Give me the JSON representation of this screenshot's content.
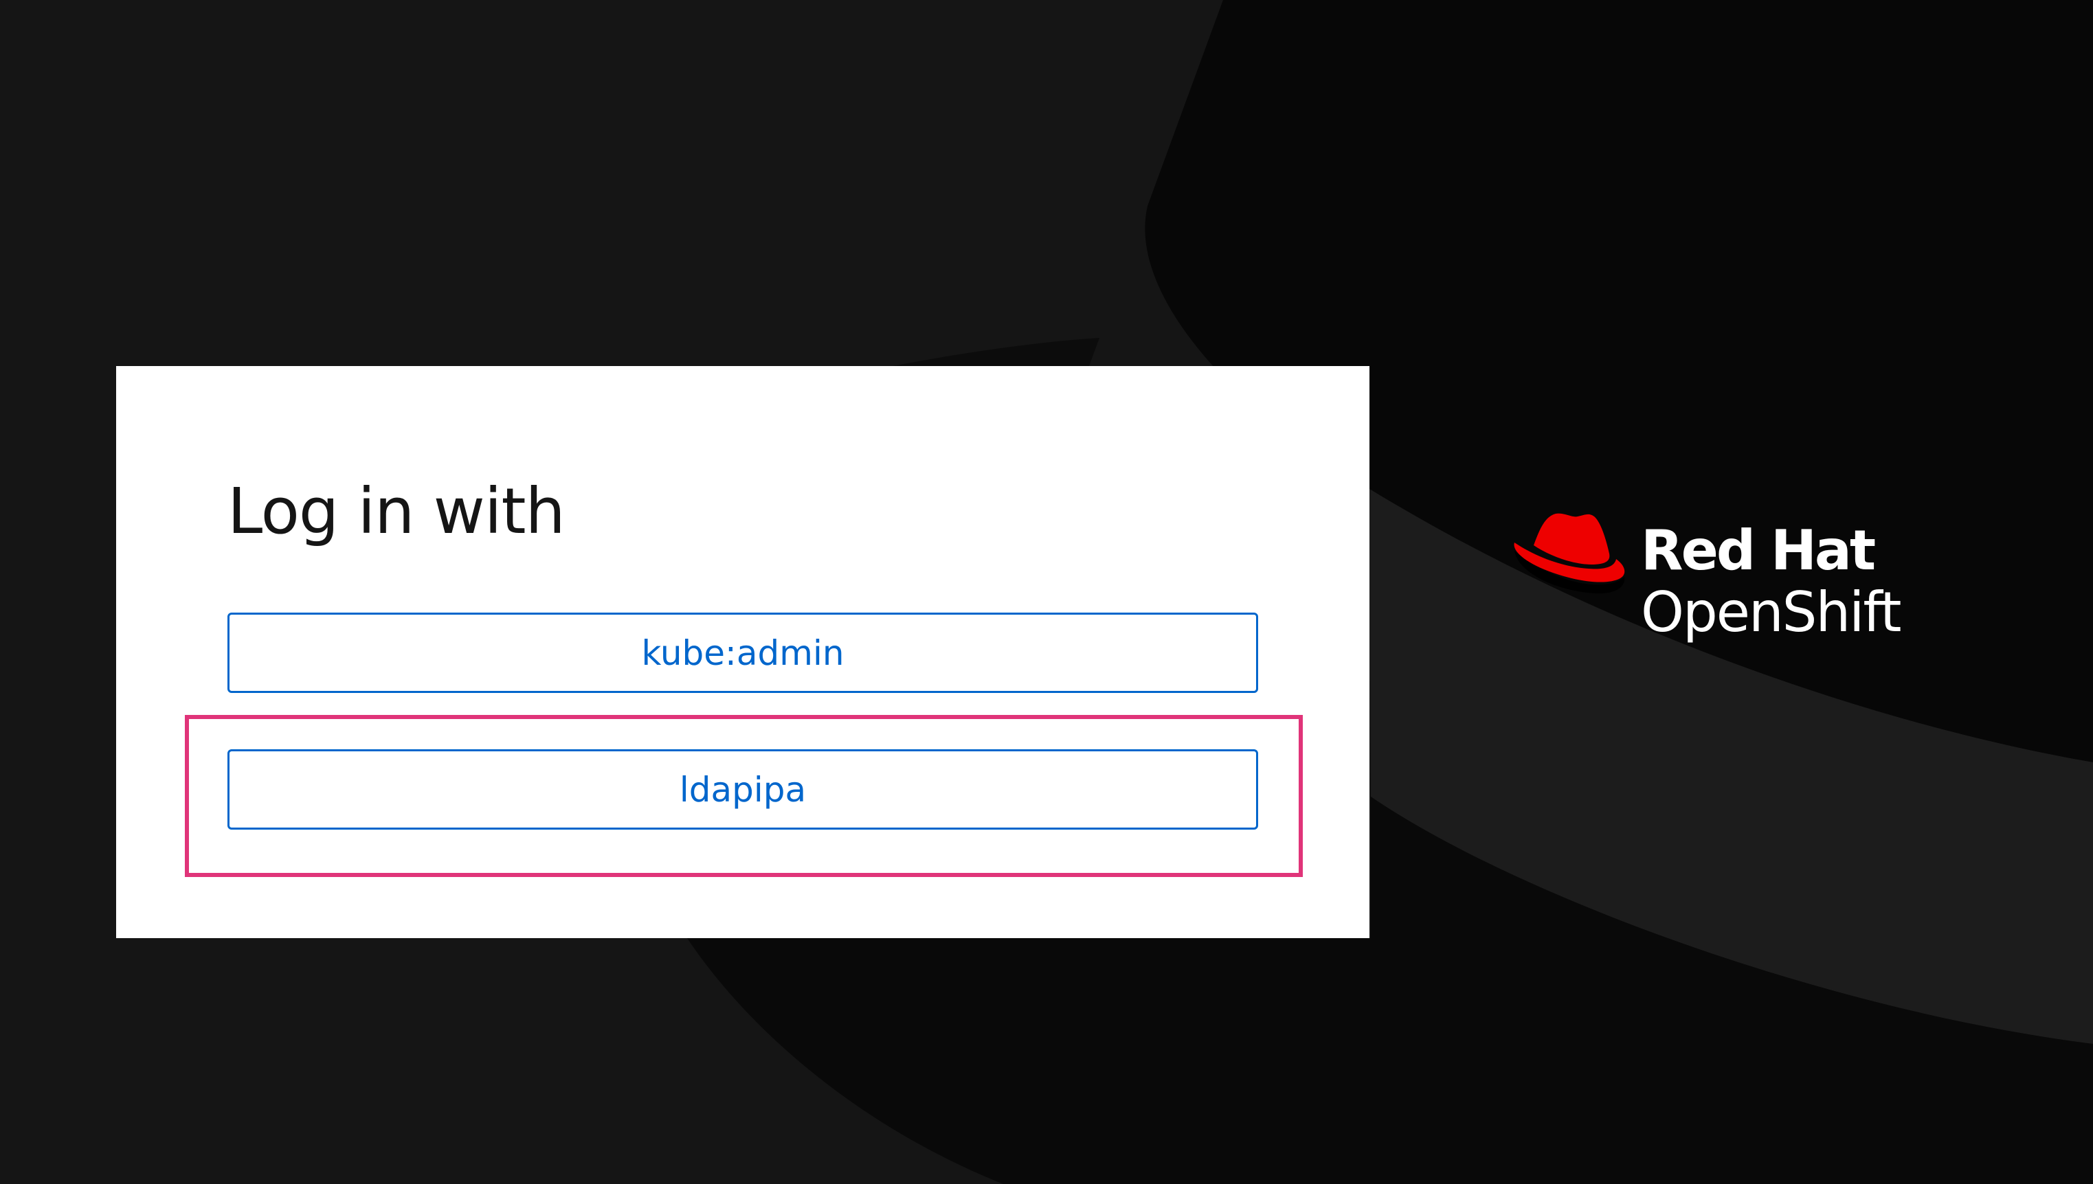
{
  "login": {
    "title": "Log in with",
    "providers": [
      {
        "label": "kube:admin"
      },
      {
        "label": "ldapipa"
      }
    ]
  },
  "brand": {
    "line1": "Red Hat",
    "line2": "OpenShift"
  },
  "colors": {
    "background": "#151515",
    "card": "#ffffff",
    "link_blue": "#0066cc",
    "highlight": "#e03479",
    "brand_red": "#ee0000"
  }
}
